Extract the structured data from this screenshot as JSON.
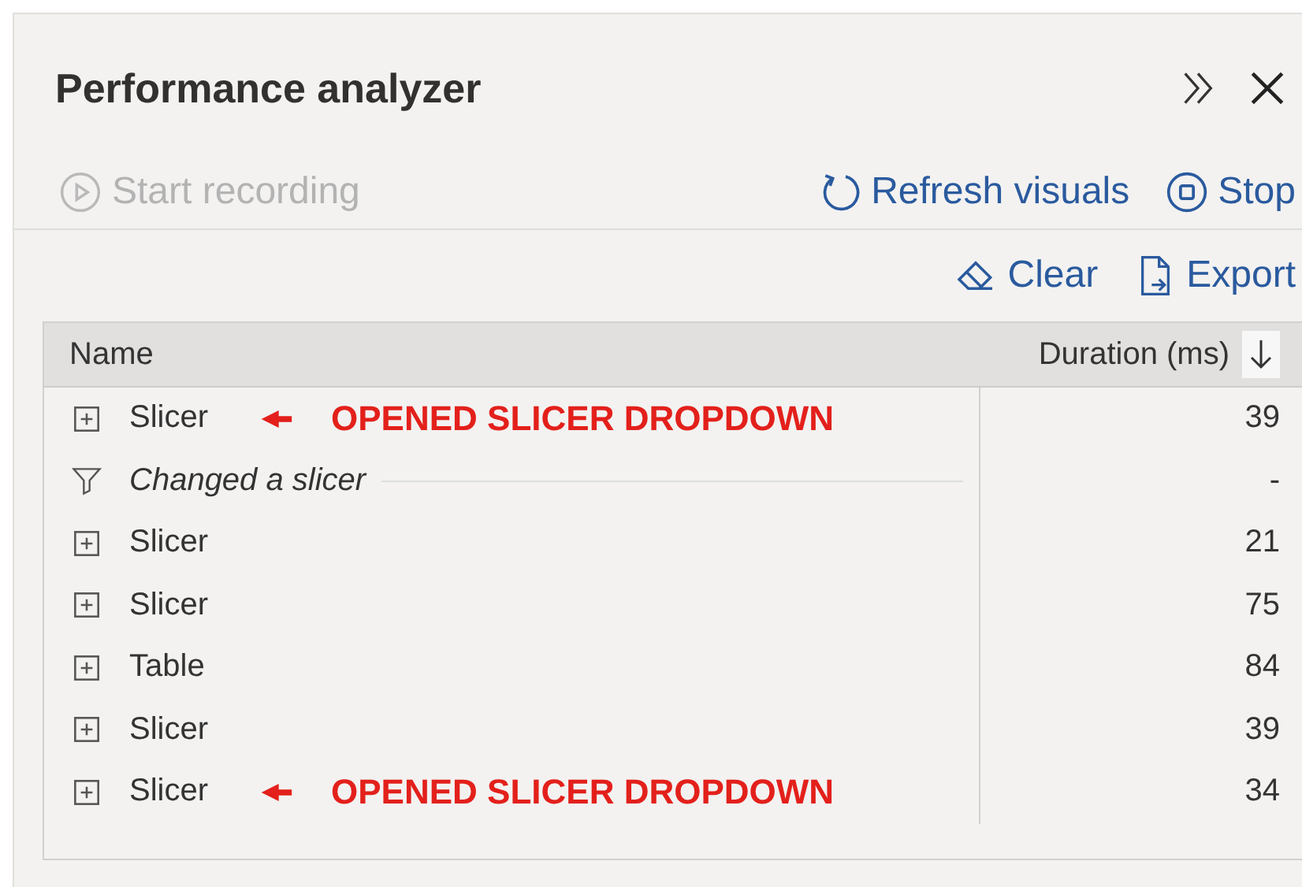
{
  "panel": {
    "title": "Performance analyzer"
  },
  "toolbar": [
    {
      "label": "Start recording",
      "kind": "play",
      "disabled": true
    },
    {
      "label": "Refresh visuals",
      "kind": "refresh",
      "disabled": false
    },
    {
      "label": "Stop",
      "kind": "stop",
      "disabled": false
    }
  ],
  "actions": [
    {
      "label": "Clear",
      "kind": "eraser"
    },
    {
      "label": "Export",
      "kind": "export"
    }
  ],
  "table": {
    "columns": [
      "Name",
      "Duration (ms)"
    ],
    "rows": [
      {
        "kind": "visual",
        "name": "Slicer",
        "duration": "39",
        "annotation": "OPENED SLICER DROPDOWN"
      },
      {
        "kind": "event",
        "name": "Changed a slicer",
        "duration": "-"
      },
      {
        "kind": "visual",
        "name": "Slicer",
        "duration": "21"
      },
      {
        "kind": "visual",
        "name": "Slicer",
        "duration": "75"
      },
      {
        "kind": "visual",
        "name": "Table",
        "duration": "84"
      },
      {
        "kind": "visual",
        "name": "Slicer",
        "duration": "39"
      },
      {
        "kind": "visual",
        "name": "Slicer",
        "duration": "34",
        "annotation": "OPENED SLICER DROPDOWN"
      }
    ]
  }
}
